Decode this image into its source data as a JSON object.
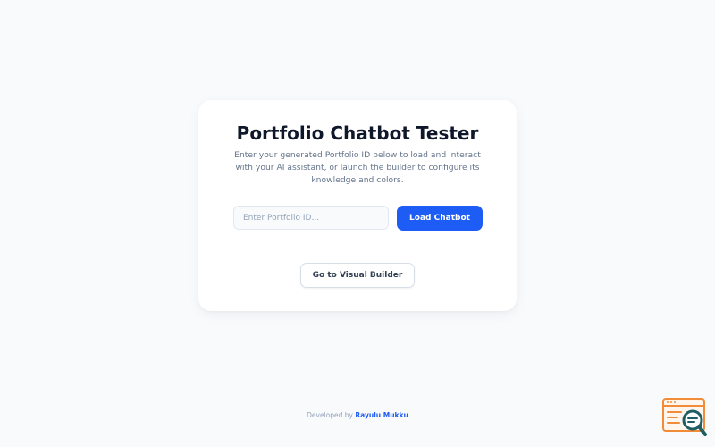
{
  "card": {
    "title": "Portfolio Chatbot Tester",
    "description": "Enter your generated Portfolio ID below to load and interact with your AI assistant, or launch the builder to configure its knowledge and colors."
  },
  "portfolio_input": {
    "placeholder": "Enter Portfolio ID...",
    "value": ""
  },
  "buttons": {
    "load_label": "Load Chatbot",
    "builder_label": "Go to Visual Builder"
  },
  "footer": {
    "prefix": "Developed by",
    "author": "Rayulu Mukku"
  },
  "widget": {
    "icon": "browser-search-icon"
  },
  "colors": {
    "accent": "#1d5cf5",
    "background": "#f8fafc",
    "widget_orange": "#f28c38",
    "widget_teal": "#1f5f63"
  }
}
